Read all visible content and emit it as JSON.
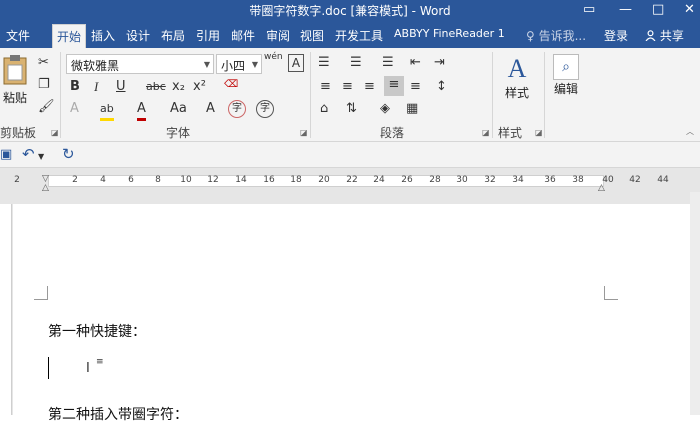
{
  "window": {
    "title": "带圈字符数字.doc [兼容模式] - Word",
    "controls": {
      "restore": "▭",
      "minimize": "—",
      "maximize": "□",
      "close": "✕"
    }
  },
  "tabs": [
    "文件",
    "开始",
    "插入",
    "设计",
    "布局",
    "引用",
    "邮件",
    "审阅",
    "视图",
    "开发工具",
    "ABBYY FineReader 1"
  ],
  "active_tab": "开始",
  "tell_me": "♀ 告诉我...",
  "account": {
    "login": "登录",
    "share": "共享",
    "share_icon": "person-icon"
  },
  "clipboard": {
    "paste_label": "粘贴",
    "group_label": "剪贴板"
  },
  "font": {
    "family": "微软雅黑",
    "size": "小四",
    "group_label": "字体",
    "buttons": {
      "bold": "B",
      "italic": "I",
      "underline": "U",
      "strike": "abc",
      "subscript": "x₂",
      "superscript": "x²",
      "phonetic": "wén",
      "border": "A",
      "effects": "A",
      "highlight": "ab",
      "color": "A",
      "case": "Aa",
      "enlarge": "A",
      "circle": "字"
    }
  },
  "paragraph": {
    "group_label": "段落"
  },
  "styles": {
    "label": "样式",
    "group_label": "样式"
  },
  "editing": {
    "label": "编辑"
  },
  "quick_access": {
    "undo": "↶",
    "redo": "↻"
  },
  "ruler": {
    "ticks": [
      "2",
      "2",
      "4",
      "6",
      "8",
      "10",
      "12",
      "14",
      "16",
      "18",
      "20",
      "22",
      "24",
      "26",
      "28",
      "30",
      "32",
      "34",
      "36",
      "38",
      "40",
      "42",
      "44"
    ]
  },
  "document": {
    "line1": "第一种快捷键：",
    "line2": "第二种插入带圈字符："
  },
  "colors": {
    "brand": "#2b579a",
    "ribbon": "#f3f3f3",
    "highlight": "#ffd800",
    "font_color": "#c00000"
  }
}
